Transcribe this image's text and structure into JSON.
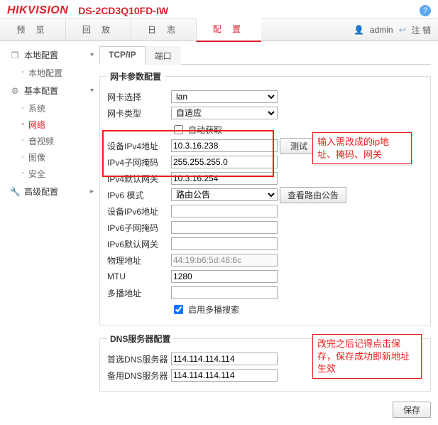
{
  "header": {
    "brand": "HIKVISION",
    "model": "DS-2CD3Q10FD-IW"
  },
  "tabs": {
    "preview": "预 览",
    "playback": "回 放",
    "log": "日 志",
    "config": "配 置"
  },
  "userbar": {
    "username": "admin",
    "logout": "注 销"
  },
  "sidebar": {
    "local": "本地配置",
    "local_item": "本地配置",
    "basic": "基本配置",
    "basic_items": {
      "system": "系统",
      "network": "网络",
      "video": "音视频",
      "image": "图像",
      "security": "安全"
    },
    "advanced": "高级配置"
  },
  "subtabs": {
    "tcpip": "TCP/IP",
    "port": "端口"
  },
  "nic": {
    "legend": "网卡参数配置",
    "nic_select_label": "网卡选择",
    "nic_select_value": "lan",
    "nic_type_label": "网卡类型",
    "nic_type_value": "自适应",
    "auto_label": "自动获取",
    "ipv4_addr_label": "设备IPv4地址",
    "ipv4_addr_value": "10.3.16.238",
    "test_label": "测试",
    "ipv4_mask_label": "IPv4子网掩码",
    "ipv4_mask_value": "255.255.255.0",
    "ipv4_gw_label": "IPv4默认网关",
    "ipv4_gw_value": "10.3.16.254",
    "ipv6_mode_label": "IPv6 模式",
    "ipv6_mode_value": "路由公告",
    "ipv6_route_btn": "查看路由公告",
    "ipv6_addr_label": "设备IPv6地址",
    "ipv6_mask_label": "IPv6子网掩码",
    "ipv6_gw_label": "IPv6默认网关",
    "mac_label": "物理地址",
    "mac_value": "44:19:b6:5d:48:6c",
    "mtu_label": "MTU",
    "mtu_value": "1280",
    "multicast_label": "多播地址",
    "multi_search_label": "启用多播搜索"
  },
  "dns": {
    "legend": "DNS服务器配置",
    "primary_label": "首选DNS服务器",
    "primary_value": "114.114.114.114",
    "backup_label": "备用DNS服务器",
    "backup_value": "114.114.114.114"
  },
  "save_label": "保存",
  "annotations": {
    "ip_note": "输入需改成的ip地址、掩码、网关",
    "save_note": "改完之后记得点击保存，保存成功即新地址生效"
  }
}
